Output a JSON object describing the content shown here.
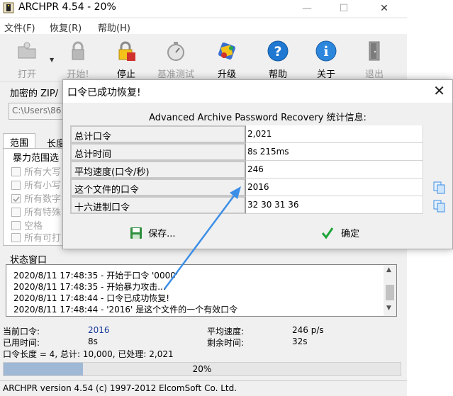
{
  "app": {
    "title": "ARCHPR 4.54 - 20%",
    "window_buttons": {
      "minimize": "—",
      "maximize": "☐",
      "close": "✕"
    }
  },
  "menu": [
    "文件(F)",
    "恢复(R)",
    "帮助(H)"
  ],
  "toolbar": [
    {
      "name": "open",
      "label": "打开",
      "icon": "open-folder-icon",
      "enabled": false
    },
    {
      "name": "start",
      "label": "开始!",
      "icon": "start-lock-icon",
      "enabled": false
    },
    {
      "name": "stop",
      "label": "停止",
      "icon": "stop-lock-icon",
      "enabled": true
    },
    {
      "name": "benchmark",
      "label": "基准测试",
      "icon": "stopwatch-icon",
      "enabled": false
    },
    {
      "name": "upgrade",
      "label": "升级",
      "icon": "upgrade-icon",
      "enabled": true
    },
    {
      "name": "help",
      "label": "帮助",
      "icon": "help-icon",
      "enabled": true
    },
    {
      "name": "about",
      "label": "关于",
      "icon": "info-icon",
      "enabled": true
    },
    {
      "name": "exit",
      "label": "退出",
      "icon": "exit-door-icon",
      "enabled": false
    }
  ],
  "encrypted_zip": {
    "label": "加密的 ZIP/",
    "path_value": "C:\\Users\\86"
  },
  "tabs": [
    "范围",
    "长度"
  ],
  "brute_range": {
    "label": "暴力范围选",
    "options": [
      {
        "label": "所有大写",
        "checked": false
      },
      {
        "label": "所有小写",
        "checked": false
      },
      {
        "label": "所有数字",
        "checked": true
      },
      {
        "label": "所有特殊",
        "checked": false
      },
      {
        "label": "空格",
        "checked": false
      },
      {
        "label": "所有可打",
        "checked": false
      }
    ]
  },
  "status_window": {
    "label": "状态窗口",
    "lines": [
      "2020/8/11 17:48:35 - 开始于口令 '0000'",
      "2020/8/11 17:48:35 - 开始暴力攻击...",
      "2020/8/11 17:48:44 - 口令已成功恢复!",
      "2020/8/11 17:48:44 - '2016' 是这个文件的一个有效口令"
    ]
  },
  "stats": {
    "current_password_label": "当前口令:",
    "current_password_value": "2016",
    "elapsed_label": "已用时间:",
    "elapsed_value": "8s",
    "avg_speed_label": "平均速度:",
    "avg_speed_value": "246 p/s",
    "remaining_label": "剩余时间:",
    "remaining_value": "32s",
    "length_line": "口令长度 = 4, 总计: 10,000, 已处理: 2,021"
  },
  "progress": {
    "value": 0.2,
    "text": "20%"
  },
  "statusbar": {
    "text": "ARCHPR version 4.54 (c) 1997-2012 ElcomSoft Co. Ltd."
  },
  "dialog": {
    "title": "口令已成功恢复!",
    "close": "✕",
    "header": "Advanced Archive Password Recovery 统计信息:",
    "rows": [
      {
        "label": "总计口令",
        "value": "2,021",
        "copy": false
      },
      {
        "label": "总计时间",
        "value": "8s 215ms",
        "copy": false
      },
      {
        "label": "平均速度(口令/秒)",
        "value": "246",
        "copy": false
      },
      {
        "label": "这个文件的口令",
        "value": "2016",
        "copy": true
      },
      {
        "label": "十六进制口令",
        "value": "32 30 31 36",
        "copy": true
      }
    ],
    "save_button": "保存...",
    "ok_button": "确定"
  },
  "colors": {
    "arrow": "#3c8ee6",
    "progress_fill": "#9fb8d6",
    "ok_check": "#1fa53a",
    "save_icon": "#2f8f3e",
    "value_blue": "#1a3a9a"
  }
}
